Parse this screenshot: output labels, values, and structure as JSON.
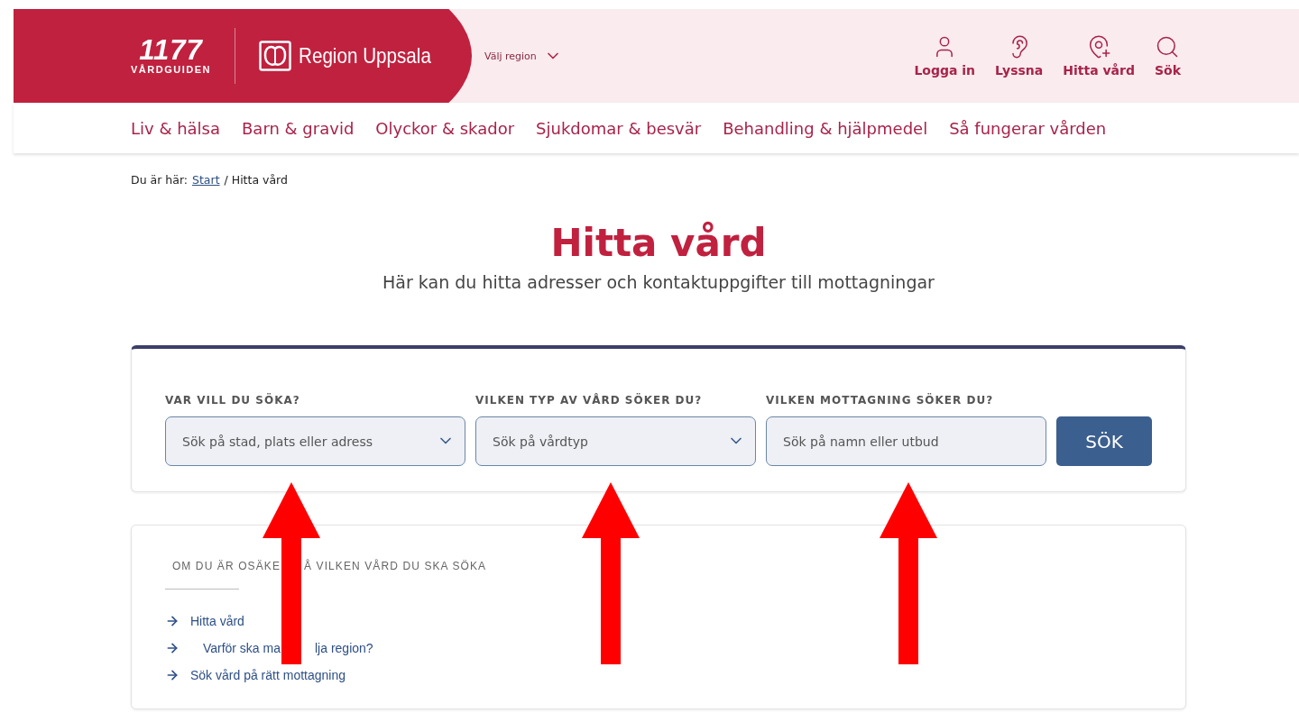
{
  "header": {
    "logo": {
      "number": "1177",
      "name": "VÅRDGUIDEN"
    },
    "region_logo": "Region Uppsala",
    "region_picker": "Välj region",
    "actions": [
      {
        "label": "Logga in",
        "kind": "user"
      },
      {
        "label": "Lyssna",
        "kind": "ear"
      },
      {
        "label": "Hitta vård",
        "kind": "pin"
      },
      {
        "label": "Sök",
        "kind": "search"
      }
    ]
  },
  "nav": [
    "Liv & hälsa",
    "Barn & gravid",
    "Olyckor & skador",
    "Sjukdomar & besvär",
    "Behandling & hjälpmedel",
    "Så fungerar vården"
  ],
  "breadcrumb": {
    "prefix": "Du är här:",
    "link": "Start",
    "current": "/ Hitta vård"
  },
  "title": "Hitta vård",
  "subtitle": "Här kan du hitta adresser och kontaktuppgifter till mottagningar",
  "search": {
    "fields": [
      {
        "label": "VAR VILL DU SÖKA?",
        "placeholder": "Sök på stad, plats eller adress",
        "kind": "dropdown"
      },
      {
        "label": "VILKEN TYP AV VÅRD SÖKER DU?",
        "placeholder": "Sök på vårdtyp",
        "kind": "dropdown"
      },
      {
        "label": "VILKEN MOTTAGNING SÖKER DU?",
        "placeholder": "Sök på namn eller utbud",
        "kind": "text"
      }
    ],
    "button": "SÖK"
  },
  "help": {
    "heading": {
      "parts": [
        "OM DU ÄR OSÄKE",
        "Å VILKEN VÅRD DU SKA SÖKA"
      ]
    },
    "links": [
      {
        "parts": [
          "Hitta vård"
        ]
      },
      {
        "parts": [
          "Varför ska ma",
          "lja region?"
        ]
      },
      {
        "parts": [
          "Sök vård på rätt mottagning"
        ]
      }
    ]
  },
  "annotations": [
    {
      "kind": "arrow"
    },
    {
      "kind": "arrow"
    },
    {
      "kind": "arrow"
    }
  ]
}
